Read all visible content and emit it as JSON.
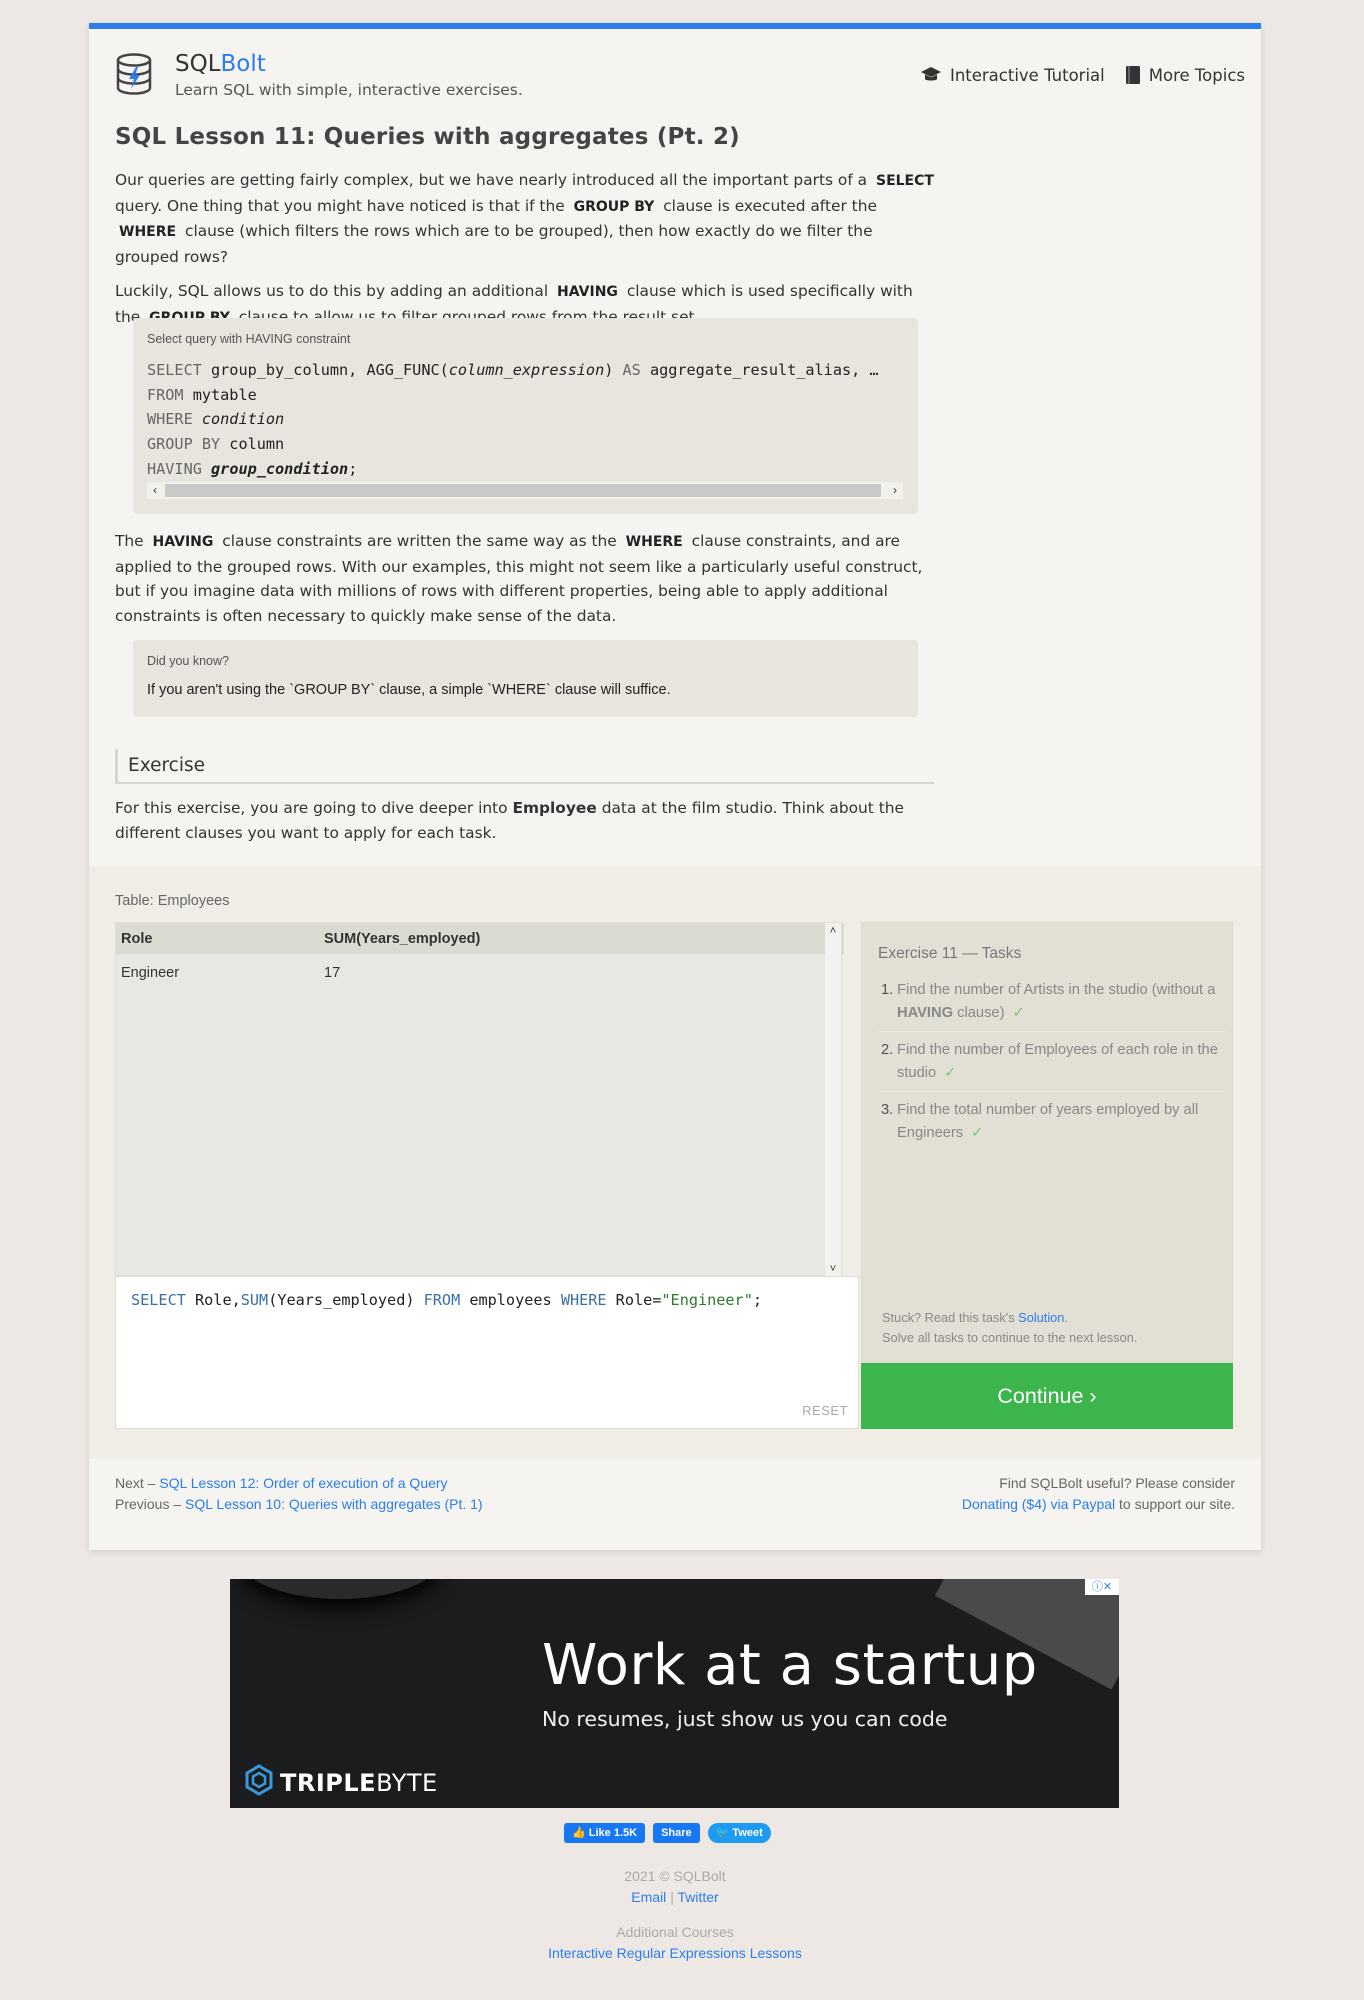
{
  "header": {
    "brand_sql": "SQL",
    "brand_bolt": "Bolt",
    "tagline": "Learn SQL with simple, interactive exercises.",
    "nav": [
      {
        "label": "Interactive Tutorial",
        "icon": "graduation-cap-icon"
      },
      {
        "label": "More Topics",
        "icon": "book-icon"
      }
    ]
  },
  "lesson": {
    "title": "SQL Lesson 11: Queries with aggregates (Pt. 2)",
    "p1": {
      "a": "Our queries are getting fairly complex, but we have nearly introduced all the important parts of a",
      "kw1": "SELECT",
      "b": "query. One thing that you might have noticed is that if the",
      "kw2": "GROUP BY",
      "c": "clause is executed after the",
      "kw3": "WHERE",
      "d": "clause (which filters the rows which are to be grouped), then how exactly do we filter the grouped rows?"
    },
    "p2": {
      "a": "Luckily, SQL allows us to do this by adding an additional",
      "kw1": "HAVING",
      "b": "clause which is used specifically with the",
      "kw2": "GROUP BY",
      "c": "clause to allow us to filter grouped rows from the result set."
    },
    "codebox": {
      "title": "Select query with HAVING constraint",
      "line1": {
        "kw": "SELECT",
        "a": " group_by_column, AGG_FUNC(",
        "it": "column_expression",
        "b": ") ",
        "kw2": "AS",
        "c": " aggregate_result_alias, …"
      },
      "line2": {
        "kw": "FROM",
        "a": " mytable"
      },
      "line3": {
        "kw": "WHERE",
        "it": "condition"
      },
      "line4": {
        "kw": "GROUP BY",
        "a": " column"
      },
      "line5": {
        "kw": "HAVING",
        "it": "group_condition",
        "end": ";"
      }
    },
    "p3": {
      "a": "The",
      "kw1": "HAVING",
      "b": "clause constraints are written the same way as the",
      "kw2": "WHERE",
      "c": "clause constraints, and are applied to the grouped rows. With our examples, this might not seem like a particularly useful construct, but if you imagine data with millions of rows with different properties, being able to apply additional constraints is often necessary to quickly make sense of the data."
    },
    "tip": {
      "title": "Did you know?",
      "text": "If you aren't using the `GROUP BY` clause, a simple `WHERE` clause will suffice."
    },
    "exercise_heading": "Exercise",
    "exercise_desc": {
      "a": "For this exercise, you are going to dive deeper into",
      "b": "Employee",
      "c": "data at the film studio. Think about the different clauses you want to apply for each task."
    }
  },
  "exercise": {
    "table_label": "Table: Employees",
    "columns": [
      "Role",
      "SUM(Years_employed)"
    ],
    "rows": [
      [
        "Engineer",
        "17"
      ]
    ],
    "query": {
      "kw1": "SELECT",
      "a": " Role,",
      "fn": "SUM",
      "b": "(Years_employed) ",
      "kw2": "FROM",
      "c": " employees ",
      "kw3": "WHERE",
      "d": " Role=",
      "str": "\"Engineer\"",
      "e": ";"
    },
    "reset_label": "RESET",
    "tasks_title": "Exercise 11 — Tasks",
    "tasks": [
      {
        "num": "1.",
        "a": "Find the number of Artists in the studio (without a",
        "b": "HAVING",
        "c": "clause)",
        "check": "✓"
      },
      {
        "num": "2.",
        "a": "Find the number of Employees of each role in the studio",
        "check": "✓"
      },
      {
        "num": "3.",
        "a": "Find the total number of years employed by all Engineers",
        "check": "✓"
      }
    ],
    "stuck_a": "Stuck? Read this task's",
    "stuck_link": "Solution",
    "stuck_b": ".",
    "solve_all": "Solve all tasks to continue to the next lesson.",
    "continue_label": "Continue ›"
  },
  "footnav": {
    "next_prefix": "Next –",
    "next_link": "SQL Lesson 12: Order of execution of a Query",
    "prev_prefix": "Previous –",
    "prev_link": "SQL Lesson 10: Queries with aggregates (Pt. 1)",
    "donate_a": "Find SQLBolt useful? Please consider",
    "donate_link": "Donating ($4) via Paypal",
    "donate_b": "to support our site."
  },
  "ad": {
    "headline": "Work at a startup",
    "sub": "No resumes, just show us you can code",
    "brand_bold": "TRIPLE",
    "brand_light": "BYTE"
  },
  "social": {
    "like": "Like 1.5K",
    "share": "Share",
    "tweet": "Tweet"
  },
  "footer": {
    "copyright": "2021 © SQLBolt",
    "email": "Email",
    "twitter": "Twitter",
    "sep": "|",
    "additional": "Additional Courses",
    "regex_link": "Interactive Regular Expressions Lessons"
  },
  "colors": {
    "accent": "#2b7de9",
    "continue": "#3cb64c",
    "check": "#7bc67b"
  }
}
